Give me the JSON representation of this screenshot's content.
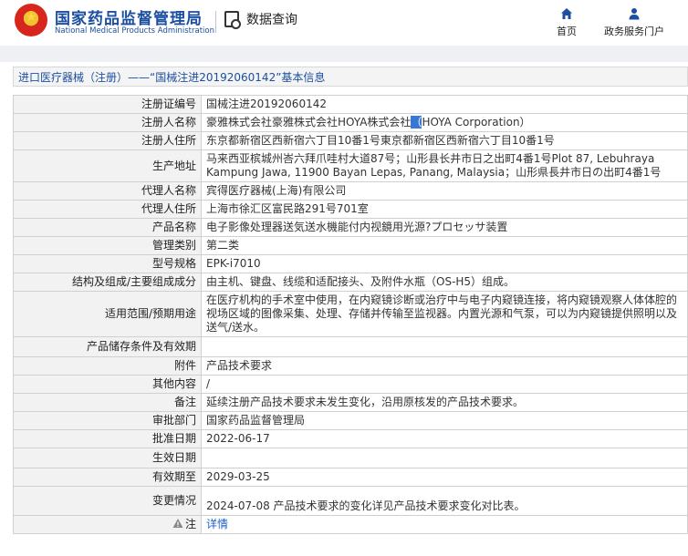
{
  "header": {
    "brand_cn": "国家药品监督管理局",
    "brand_en": "National Medical Products Administration",
    "query_label": "数据查询",
    "nav": [
      {
        "label": "首页",
        "icon": "home-icon"
      },
      {
        "label": "政务服务门户",
        "icon": "user-icon"
      }
    ]
  },
  "page": {
    "title": "进口医疗器械（注册）——“国械注进20192060142”基本信息"
  },
  "fields": {
    "reg_no": {
      "label": "注册证编号",
      "value": "国械注进20192060142"
    },
    "registrant": {
      "label": "注册人名称",
      "value_before": "豪雅株式会社豪雅株式会社HOYA株式会社",
      "value_selected": "（",
      "value_after": "HOYA Corporation）"
    },
    "registrant_addr": {
      "label": "注册人住所",
      "value": "东京都新宿区西新宿六丁目10番1号東京都新宿区西新宿六丁目10番1号"
    },
    "mfg_addr": {
      "label": "生产地址",
      "value": "马来西亚槟城州峇六拜爪哇村大道87号；山形县长井市日之出町4番1号Plot 87, Lebuhraya Kampung Jawa, 11900 Bayan Lepas, Panang, Malaysia；山形県長井市日の出町4番1号"
    },
    "agent": {
      "label": "代理人名称",
      "value": "宾得医疗器械(上海)有限公司"
    },
    "agent_addr": {
      "label": "代理人住所",
      "value": "上海市徐汇区富民路291号701室"
    },
    "product_name": {
      "label": "产品名称",
      "value": "电子影像处理器送気送水機能付内视鏡用光源?プロセッサ装置"
    },
    "category": {
      "label": "管理类别",
      "value": "第二类"
    },
    "model": {
      "label": "型号规格",
      "value": "EPK-i7010"
    },
    "structure": {
      "label": "结构及组成/主要组成成分",
      "value": "由主机、键盘、线缆和适配接头、及附件水瓶（OS-H5）组成。"
    },
    "scope": {
      "label": "适用范围/预期用途",
      "value": "在医疗机构的手术室中使用，在内窥镜诊断或治疗中与电子内窥镜连接，将内窥镜观察人体体腔的视场区域的图像采集、处理、存储并传输至监视器。内置光源和气泵，可以为内窥镜提供照明以及送气/送水。"
    },
    "storage": {
      "label": "产品储存条件及有效期",
      "value": ""
    },
    "attachment": {
      "label": "附件",
      "value": "产品技术要求"
    },
    "other": {
      "label": "其他内容",
      "value": "/"
    },
    "remark": {
      "label": "备注",
      "value": "延续注册产品技术要求未发生变化，沿用原核发的产品技术要求。"
    },
    "approval_dept": {
      "label": "审批部门",
      "value": "国家药品监督管理局"
    },
    "approval_date": {
      "label": "批准日期",
      "value": "2022-06-17"
    },
    "effective_date": {
      "label": "生效日期",
      "value": ""
    },
    "valid_until": {
      "label": "有效期至",
      "value": "2029-03-25"
    },
    "change": {
      "label": "变更情况",
      "value": "2024-07-08 产品技术要求的变化详见产品技术要求变化对比表。"
    },
    "note": {
      "label": "注",
      "value": "详情"
    }
  }
}
